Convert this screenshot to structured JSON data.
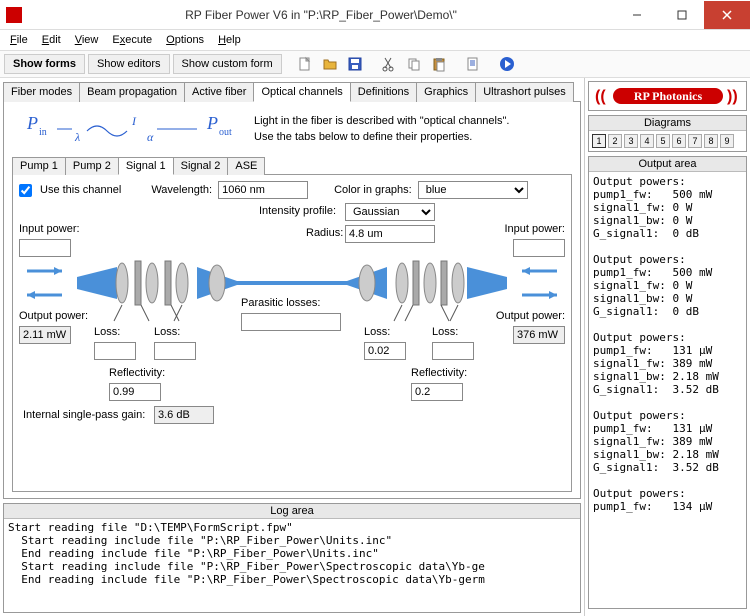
{
  "window": {
    "title": "RP Fiber Power V6 in \"P:\\RP_Fiber_Power\\Demo\\\""
  },
  "menu": [
    "File",
    "Edit",
    "View",
    "Execute",
    "Options",
    "Help"
  ],
  "toolbar": {
    "show_forms": "Show forms",
    "show_editors": "Show editors",
    "show_custom": "Show custom form"
  },
  "main_tabs": [
    "Fiber modes",
    "Beam propagation",
    "Active fiber",
    "Optical channels",
    "Definitions",
    "Graphics",
    "Ultrashort pulses"
  ],
  "main_tab_active": 3,
  "optch": {
    "desc1": "Light in the fiber is described with \"optical channels\".",
    "desc2": "Use the tabs below to define their properties.",
    "sub_tabs": [
      "Pump 1",
      "Pump 2",
      "Signal 1",
      "Signal 2",
      "ASE"
    ],
    "sub_active": 2,
    "use_channel_label": "Use this channel",
    "use_channel": true,
    "wavelength_label": "Wavelength:",
    "wavelength": "1060 nm",
    "color_label": "Color in graphs:",
    "color": "blue",
    "intensity_label": "Intensity profile:",
    "intensity": "Gaussian",
    "radius_label": "Radius:",
    "radius": "4.8 um",
    "input_power_label": "Input power:",
    "input_power_left": "",
    "input_power_right": "",
    "output_power_label": "Output power:",
    "output_power_left": "2.11 mW",
    "output_power_right": "376 mW",
    "loss_label": "Loss:",
    "loss_l1": "",
    "loss_l2": "",
    "loss_r1": "0.02",
    "loss_r2": "",
    "refl_label": "Reflectivity:",
    "refl_left": "0.99",
    "refl_right": "0.2",
    "parasitic_label": "Parasitic losses:",
    "parasitic": "",
    "gain_label": "Internal single-pass gain:",
    "gain": "3.6 dB"
  },
  "log": {
    "header": "Log area",
    "text": "Start reading file \"D:\\TEMP\\FormScript.fpw\"\n  Start reading include file \"P:\\RP_Fiber_Power\\Units.inc\"\n  End reading include file \"P:\\RP_Fiber_Power\\Units.inc\"\n  Start reading include file \"P:\\RP_Fiber_Power\\Spectroscopic data\\Yb-ge\n  End reading include file \"P:\\RP_Fiber_Power\\Spectroscopic data\\Yb-germ"
  },
  "brand": "RP Photonics",
  "diagrams": {
    "header": "Diagrams",
    "buttons": [
      "1",
      "2",
      "3",
      "4",
      "5",
      "6",
      "7",
      "8",
      "9"
    ],
    "active": 0
  },
  "output": {
    "header": "Output area",
    "text": "Output powers:\npump1_fw:   500 mW\nsignal1_fw: 0 W\nsignal1_bw: 0 W\nG_signal1:  0 dB\n\nOutput powers:\npump1_fw:   500 mW\nsignal1_fw: 0 W\nsignal1_bw: 0 W\nG_signal1:  0 dB\n\nOutput powers:\npump1_fw:   131 µW\nsignal1_fw: 389 mW\nsignal1_bw: 2.18 mW\nG_signal1:  3.52 dB\n\nOutput powers:\npump1_fw:   131 µW\nsignal1_fw: 389 mW\nsignal1_bw: 2.18 mW\nG_signal1:  3.52 dB\n\nOutput powers:\npump1_fw:   134 µW"
  }
}
